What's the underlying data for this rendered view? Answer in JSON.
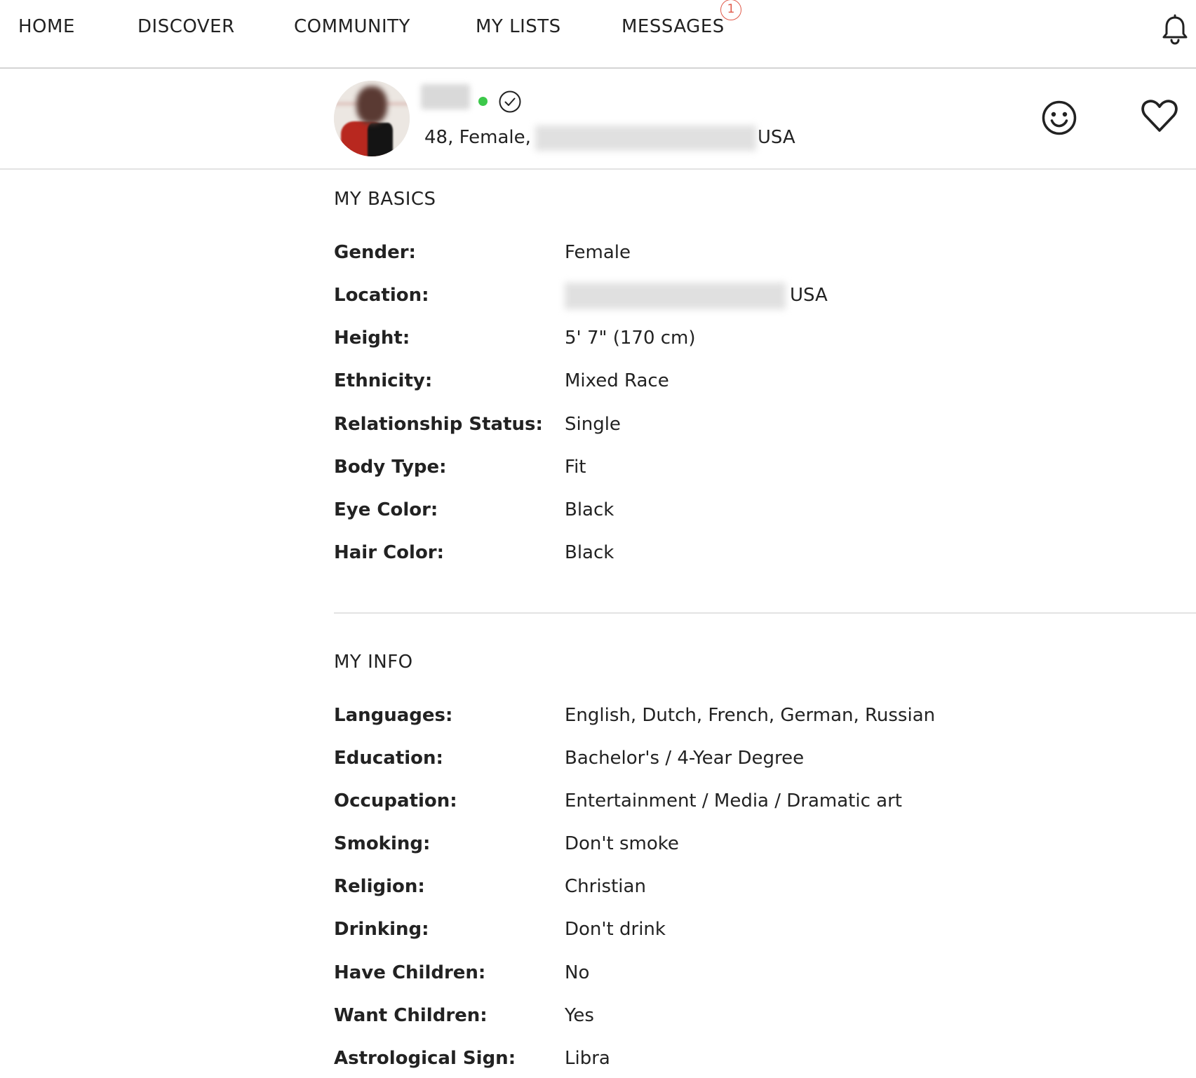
{
  "nav": {
    "items": [
      "HOME",
      "DISCOVER",
      "COMMUNITY",
      "MY LISTS",
      "MESSAGES"
    ],
    "messages_badge": "1",
    "bell_icon": "bell-icon"
  },
  "profile": {
    "summary_prefix": "48, Female,",
    "summary_country": "USA",
    "online_color": "#3cc84a",
    "icons": [
      "verified-check-icon",
      "wink-icon",
      "heart-icon"
    ]
  },
  "basics": {
    "title": "MY BASICS",
    "rows": [
      {
        "label": "Gender:",
        "value": "Female"
      },
      {
        "label": "Location:",
        "value": "USA"
      },
      {
        "label": "Height:",
        "value": "5' 7\" (170 cm)"
      },
      {
        "label": "Ethnicity:",
        "value": "Mixed Race"
      },
      {
        "label": "Relationship Status:",
        "value": "Single"
      },
      {
        "label": "Body Type:",
        "value": "Fit"
      },
      {
        "label": "Eye Color:",
        "value": "Black"
      },
      {
        "label": "Hair Color:",
        "value": "Black"
      }
    ]
  },
  "info": {
    "title": "MY INFO",
    "rows": [
      {
        "label": "Languages:",
        "value": "English, Dutch, French, German, Russian"
      },
      {
        "label": "Education:",
        "value": "Bachelor's / 4-Year Degree"
      },
      {
        "label": "Occupation:",
        "value": "Entertainment / Media / Dramatic art"
      },
      {
        "label": "Smoking:",
        "value": "Don't smoke"
      },
      {
        "label": "Religion:",
        "value": "Christian"
      },
      {
        "label": "Drinking:",
        "value": "Don't drink"
      },
      {
        "label": "Have Children:",
        "value": "No"
      },
      {
        "label": "Want Children:",
        "value": "Yes"
      },
      {
        "label": "Astrological Sign:",
        "value": "Libra"
      }
    ]
  }
}
